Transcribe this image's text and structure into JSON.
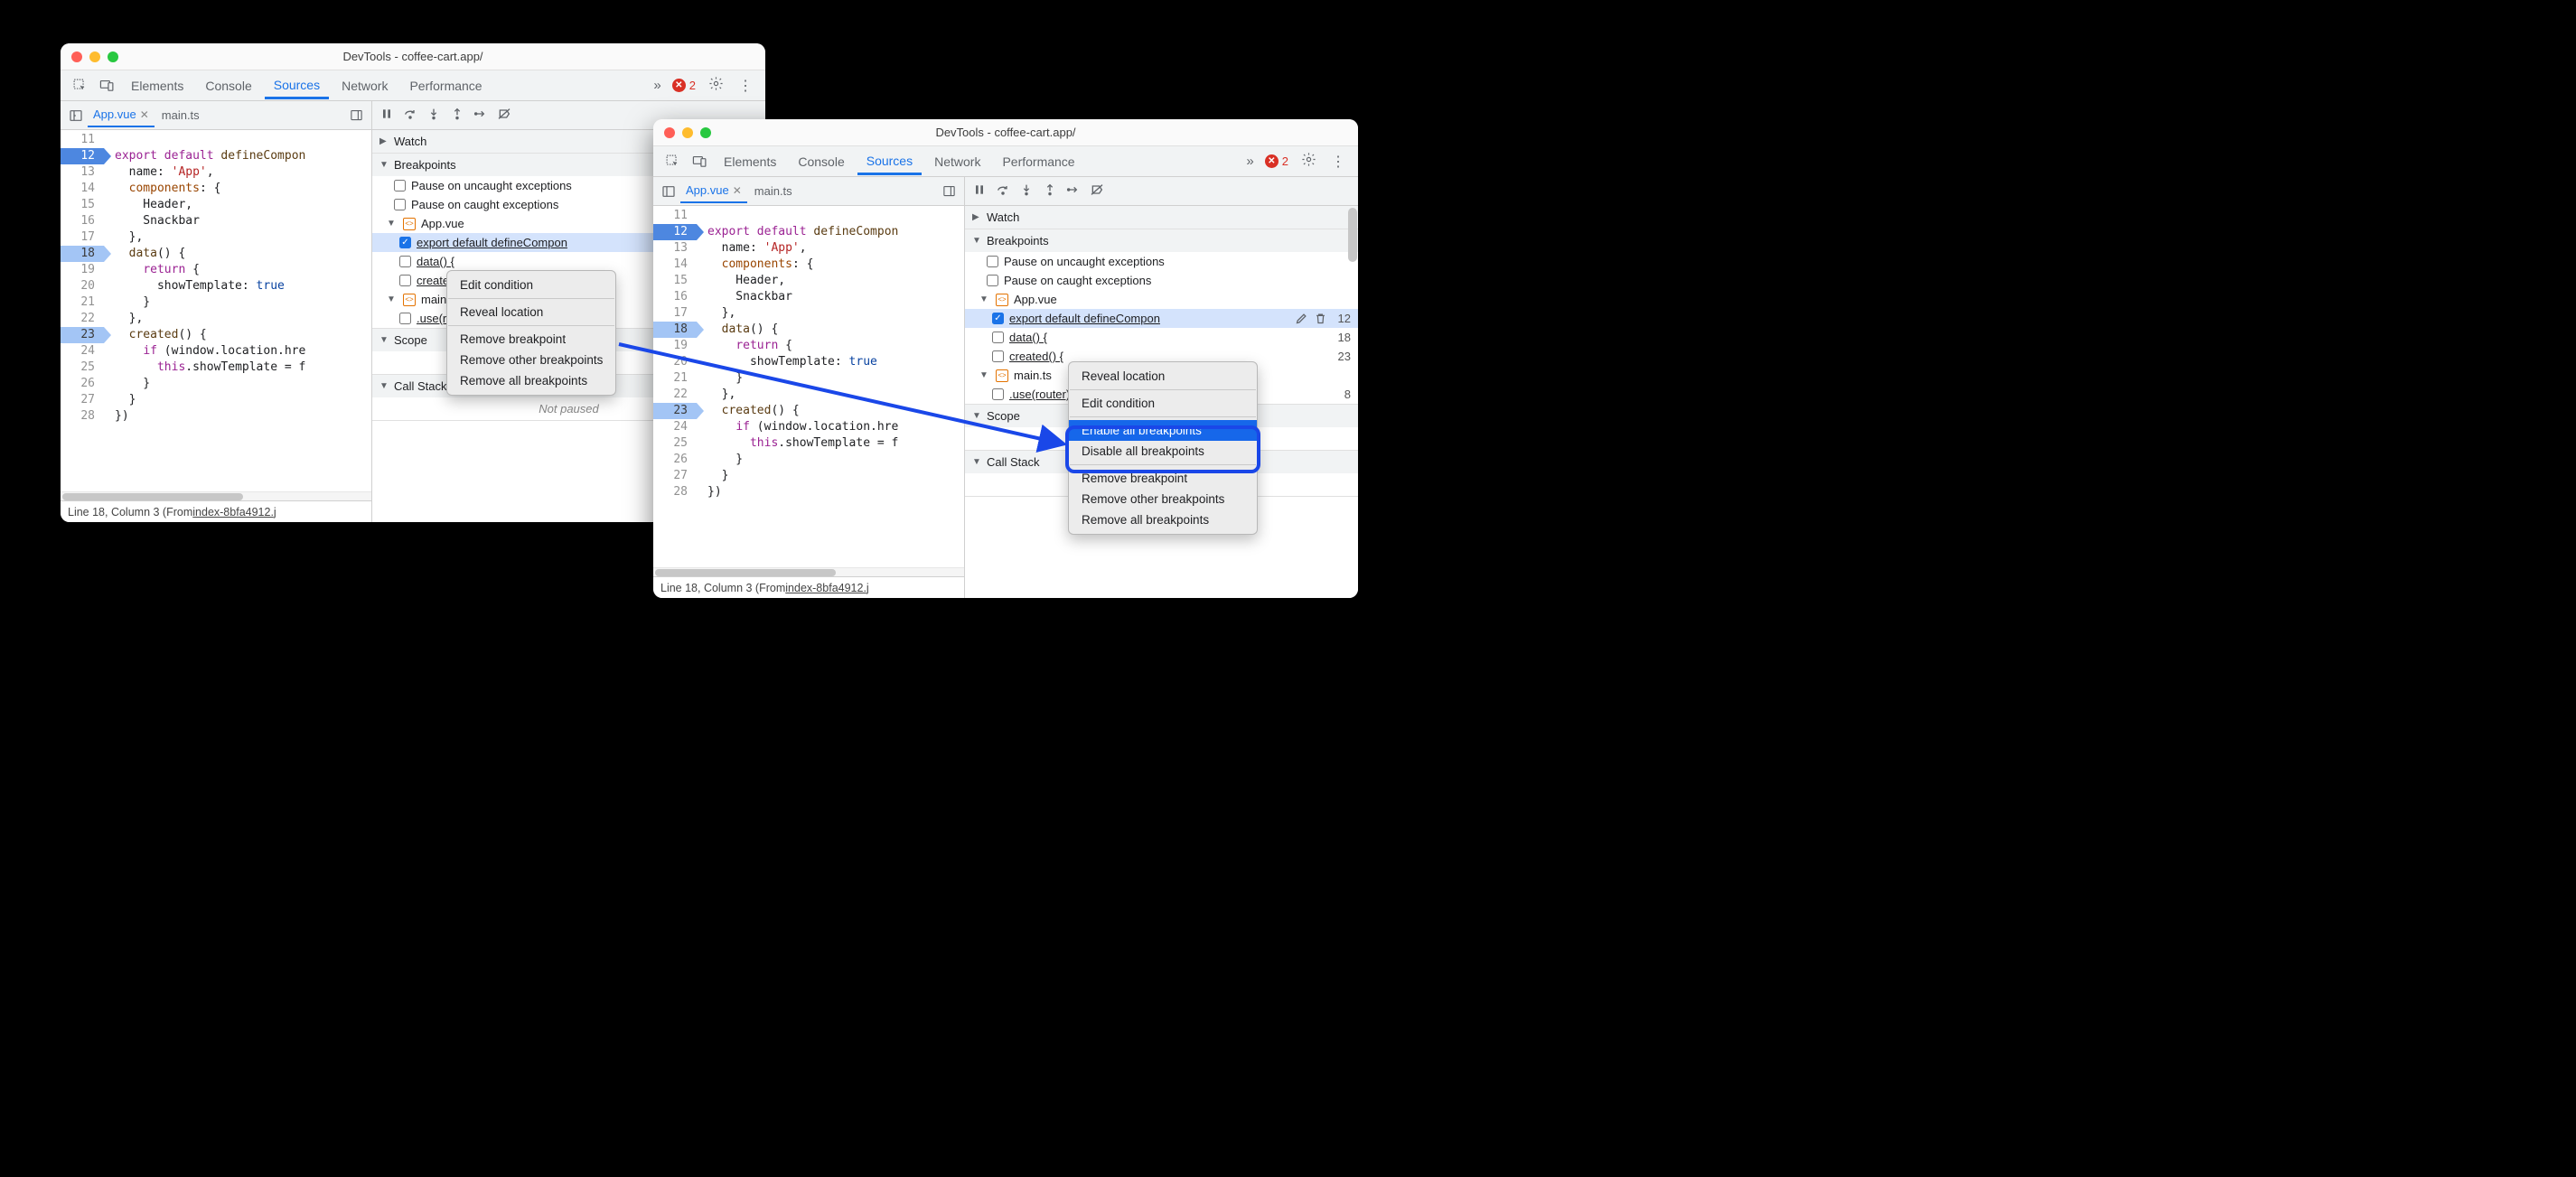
{
  "window_title": "DevTools - coffee-cart.app/",
  "toolbar_tabs": [
    "Elements",
    "Console",
    "Sources",
    "Network",
    "Performance"
  ],
  "active_toolbar_tab": "Sources",
  "error_count": "2",
  "file_tabs": {
    "active": "App.vue",
    "other": "main.ts"
  },
  "code": {
    "lines": [
      {
        "n": "11",
        "html": ""
      },
      {
        "n": "12",
        "html": "<span class='kw'>export</span> <span class='kw'>default</span> <span class='fn'>defineCompon</span>",
        "bp": true
      },
      {
        "n": "13",
        "html": "  name: <span class='str'>'App'</span>,"
      },
      {
        "n": "14",
        "html": "  <span class='prop'>components</span>: {"
      },
      {
        "n": "15",
        "html": "    Header,"
      },
      {
        "n": "16",
        "html": "    Snackbar"
      },
      {
        "n": "17",
        "html": "  },"
      },
      {
        "n": "18",
        "html": "  <span class='fn'>data</span>() {",
        "cond": true
      },
      {
        "n": "19",
        "html": "    <span class='kw'>return</span> {"
      },
      {
        "n": "20",
        "html": "      showTemplate: <span class='bool'>true</span>"
      },
      {
        "n": "21",
        "html": "    }"
      },
      {
        "n": "22",
        "html": "  },"
      },
      {
        "n": "23",
        "html": "  <span class='fn'>created</span>() {",
        "cond": true
      },
      {
        "n": "24",
        "html": "    <span class='kw'>if</span> (window.location.hre"
      },
      {
        "n": "25",
        "html": "      <span class='kw'>this</span>.showTemplate = f"
      },
      {
        "n": "26",
        "html": "    }"
      },
      {
        "n": "27",
        "html": "  }"
      },
      {
        "n": "28",
        "html": "})"
      }
    ]
  },
  "status": {
    "prefix": "Line 18, Column 3  (From ",
    "link": "index-8bfa4912.j"
  },
  "panes": {
    "watch": "Watch",
    "breakpoints": "Breakpoints",
    "uncaught": "Pause on uncaught exceptions",
    "caught": "Pause on caught exceptions",
    "bp_file1": "App.vue",
    "bp1_text": "export default defineCompon",
    "bp2_text": "data() {",
    "bp3_text": "created() {",
    "bp_file2": "main.ts",
    "bp4_text": ".use(router)",
    "scope": "Scope",
    "callstack": "Call Stack",
    "not_paused": "Not paused"
  },
  "bp_lines": {
    "l1": "12",
    "l2": "18",
    "l3": "23",
    "l4": "8"
  },
  "ctx1": {
    "edit": "Edit condition",
    "reveal": "Reveal location",
    "remove": "Remove breakpoint",
    "remove_other": "Remove other breakpoints",
    "remove_all": "Remove all breakpoints"
  },
  "ctx2": {
    "reveal": "Reveal location",
    "edit": "Edit condition",
    "enable_all": "Enable all breakpoints",
    "disable_all": "Disable all breakpoints",
    "remove": "Remove breakpoint",
    "remove_other": "Remove other breakpoints",
    "remove_all": "Remove all breakpoints"
  }
}
